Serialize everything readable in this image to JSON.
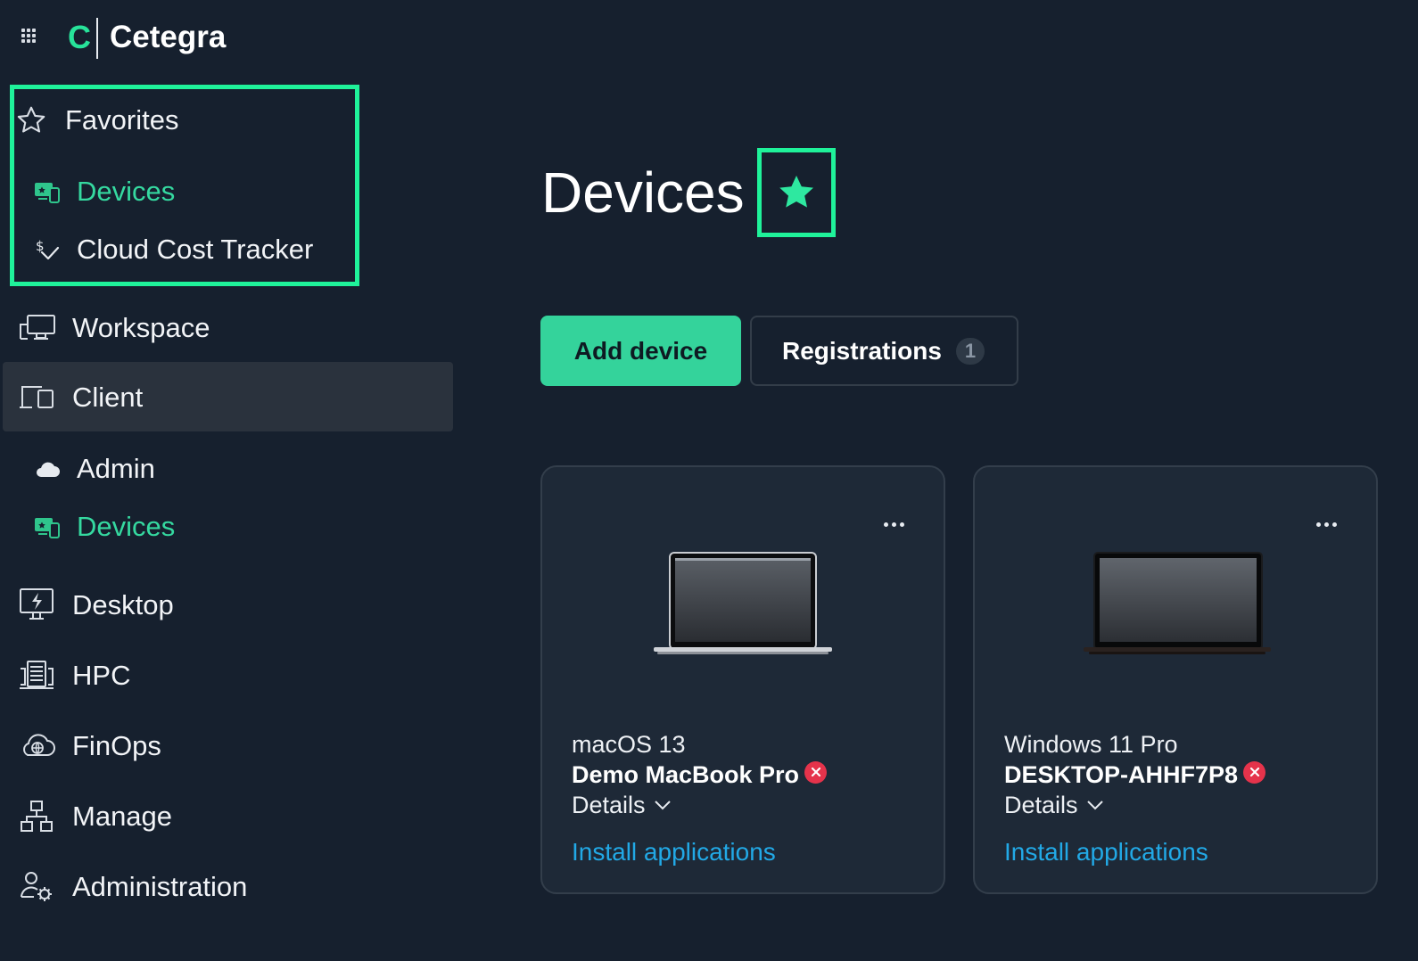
{
  "app": {
    "logo_mark": "C",
    "name": "Cetegra",
    "accent_color": "#1ff29a"
  },
  "sidebar": {
    "favorites": {
      "label": "Favorites",
      "items": [
        {
          "label": "Devices",
          "icon": "devices-icon"
        },
        {
          "label": "Cloud Cost Tracker",
          "icon": "cost-tracker-icon"
        }
      ]
    },
    "items": [
      {
        "label": "Workspace",
        "icon": "workspace-icon"
      },
      {
        "label": "Client",
        "icon": "client-icon",
        "selected": true,
        "children": [
          {
            "label": "Admin",
            "icon": "cloud-icon"
          },
          {
            "label": "Devices",
            "icon": "devices-icon",
            "active": true
          }
        ]
      },
      {
        "label": "Desktop",
        "icon": "desktop-icon"
      },
      {
        "label": "HPC",
        "icon": "hpc-icon"
      },
      {
        "label": "FinOps",
        "icon": "finops-icon"
      },
      {
        "label": "Manage",
        "icon": "manage-icon"
      },
      {
        "label": "Administration",
        "icon": "administration-icon"
      }
    ]
  },
  "main": {
    "title": "Devices",
    "favorite_star": "★",
    "add_device_label": "Add device",
    "registrations_label": "Registrations",
    "registrations_count": "1",
    "cards": [
      {
        "os": "macOS 13",
        "name": "Demo MacBook Pro",
        "status": "error",
        "details_label": "Details",
        "install_label": "Install applications",
        "laptop_style": "silver"
      },
      {
        "os": "Windows 11 Pro",
        "name": "DESKTOP-AHHF7P8",
        "status": "error",
        "details_label": "Details",
        "install_label": "Install applications",
        "laptop_style": "black"
      }
    ]
  }
}
